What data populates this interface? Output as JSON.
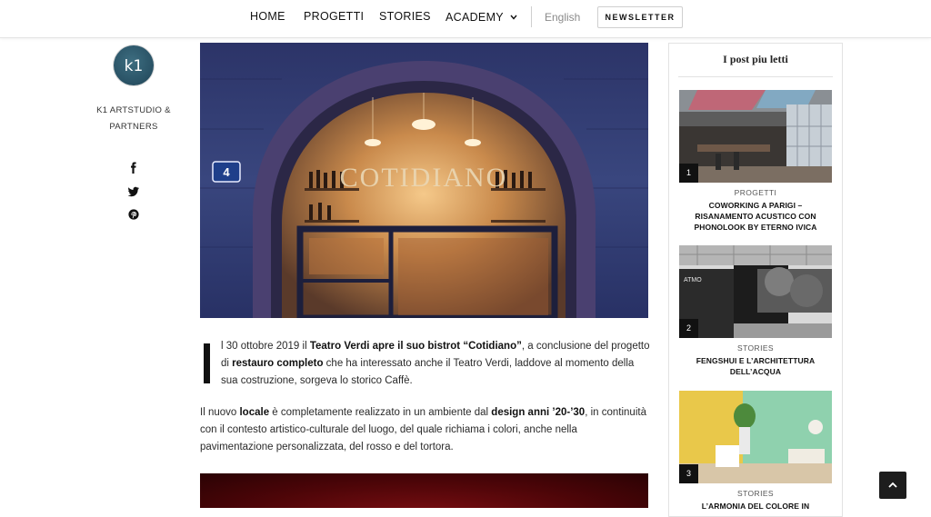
{
  "nav": {
    "items": [
      "HOME",
      "PROGETTI",
      "STORIES",
      "ACADEMY"
    ],
    "language": "English",
    "newsletter": "NEWSLETTER"
  },
  "author": {
    "logo_text": "k1",
    "name_line1": "K1 ARTSTUDIO &",
    "name_line2": "PARTNERS",
    "social_icons": [
      "facebook-icon",
      "twitter-icon",
      "pinterest-icon"
    ]
  },
  "hero": {
    "sign_text": "COTIDIANO",
    "house_number": "4"
  },
  "article": {
    "p1": {
      "t1": "l 30 ottobre 2019 il ",
      "b1": "Teatro Verdi apre il suo bistrot “Cotidiano”",
      "t2": ", a conclusione del progetto di ",
      "b2": "restauro completo",
      "t3": " che ha interessato anche il Teatro Verdi, laddove al momento della sua costruzione, sorgeva lo storico Caffè."
    },
    "p2": {
      "t1": "Il nuovo ",
      "b1": "locale",
      "t2": " è completamente realizzato in un ambiente dal ",
      "b2": "design anni ’20-’30",
      "t3": ", in continuità con il contesto artistico-culturale del luogo, del quale richiama i colori, anche nella pavimentazione personalizzata, del rosso e del tortora."
    }
  },
  "sidebar": {
    "title": "I post piu letti",
    "posts": [
      {
        "num": "1",
        "category": "PROGETTI",
        "title": "COWORKING A PARIGI – RISANAMENTO ACUSTICO CON PHONOLOOK BY ETERNO IVICA"
      },
      {
        "num": "2",
        "category": "STORIES",
        "title": "FENGSHUI E L’ARCHITETTURA DELL’ACQUA",
        "image_text": "ATMO"
      },
      {
        "num": "3",
        "category": "STORIES",
        "title": "L’ARMONIA DEL COLORE IN"
      }
    ]
  },
  "colors": {
    "accent": "#111111",
    "link_gray": "#8a8a8a",
    "logo_teal": "#2a5366"
  }
}
